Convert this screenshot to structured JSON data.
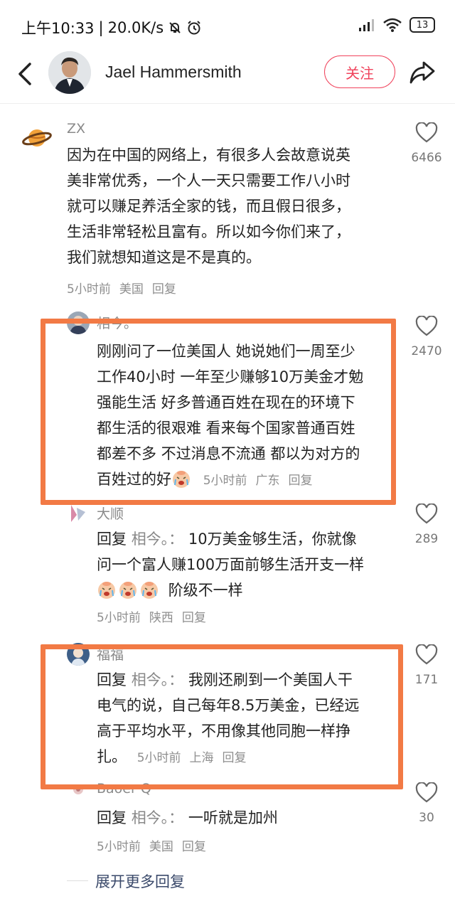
{
  "status_bar": {
    "time": "上午10:33",
    "separator": "|",
    "speed": "20.0K/s",
    "battery": "13"
  },
  "header": {
    "name": "Jael Hammersmith",
    "follow_label": "关注"
  },
  "comments": [
    {
      "author": "ZX",
      "lines": [
        "因为在中国的网络上，有很多人会故意说英",
        "美非常优秀，一个人一天只需要工作八小时",
        "就可以赚足养活全家的钱，而且假日很多，",
        "生活非常轻松且富有。所以如今你们来了，",
        "我们就想知道这是不是真的。"
      ],
      "time": "5小时前",
      "location": "美国",
      "reply": "回复",
      "likes": "6466"
    },
    {
      "author": "相今。",
      "lines": [
        "刚刚问了一位美国人 她说她们一周至少",
        "工作40小时 一年至少赚够10万美金才勉",
        "强能生活 好多普通百姓在现在的环境下",
        "都生活的很艰难 看来每个国家普通百姓",
        "都差不多 不过消息不流通 都以为对方的",
        "百姓过的好"
      ],
      "time": "5小时前",
      "location": "广东",
      "reply": "回复",
      "likes": "2470"
    },
    {
      "author": "大顺",
      "reply_prefix": "回复",
      "reply_target": "相今。：",
      "lines": [
        "10万美金够生活，你就像",
        "问一个富人赚100万面前够生活开支一样",
        "阶级不一样"
      ],
      "time": "5小时前",
      "location": "陕西",
      "reply": "回复",
      "likes": "289"
    },
    {
      "author": "福福",
      "reply_prefix": "回复",
      "reply_target": "相今。：",
      "lines": [
        "我刚还刷到一个美国人干",
        "电气的说，自己每年8.5万美金，已经远",
        "高于平均水平，不用像其他同胞一样挣",
        "扎。"
      ],
      "time": "5小时前",
      "location": "上海",
      "reply": "回复",
      "likes": "171"
    },
    {
      "author": "Baoer Q",
      "reply_prefix": "回复",
      "reply_target": "相今。：",
      "lines": [
        "一听就是加州"
      ],
      "time": "5小时前",
      "location": "美国",
      "reply": "回复",
      "likes": "30"
    }
  ],
  "expand_label": "展开更多回复",
  "colors": {
    "accent": "#f0435c",
    "highlight": "#f27a45",
    "meta": "#8e8e8e"
  },
  "icons": [
    "back-arrow-icon",
    "share-icon",
    "heart-icon",
    "crying-emoji-icon",
    "planet-icon",
    "mute-bell-icon",
    "alarm-icon",
    "signal-icon",
    "wifi-icon",
    "battery-icon"
  ]
}
